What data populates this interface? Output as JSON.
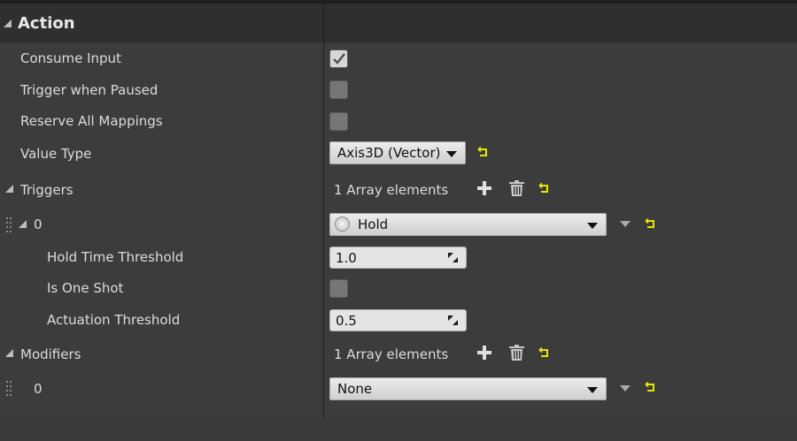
{
  "section": {
    "title": "Action"
  },
  "rows": {
    "consume_input": {
      "label": "Consume Input",
      "checked": true
    },
    "trigger_when_paused": {
      "label": "Trigger when Paused",
      "checked": false
    },
    "reserve_all_mappings": {
      "label": "Reserve All Mappings",
      "checked": false
    },
    "value_type": {
      "label": "Value Type",
      "value": "Axis3D (Vector)"
    },
    "triggers": {
      "label": "Triggers",
      "count_text": "1 Array elements"
    },
    "trigger_0": {
      "index": "0",
      "value": "Hold"
    },
    "hold_time_threshold": {
      "label": "Hold Time Threshold",
      "value": "1.0"
    },
    "is_one_shot": {
      "label": "Is One Shot",
      "checked": false
    },
    "actuation_threshold": {
      "label": "Actuation Threshold",
      "value": "0.5"
    },
    "modifiers": {
      "label": "Modifiers",
      "count_text": "1 Array elements"
    },
    "modifier_0": {
      "index": "0",
      "value": "None"
    }
  },
  "colors": {
    "background": "#3c3c3c",
    "header": "#2f2f2f",
    "reset_arrow": "#e6e600"
  },
  "icons": [
    "expand-triangle-icon",
    "checkmark-icon",
    "reset-to-default-icon",
    "add-icon",
    "trash-icon",
    "grip-handle-icon",
    "resize-icon",
    "dropdown-arrow-icon",
    "radio-icon"
  ]
}
